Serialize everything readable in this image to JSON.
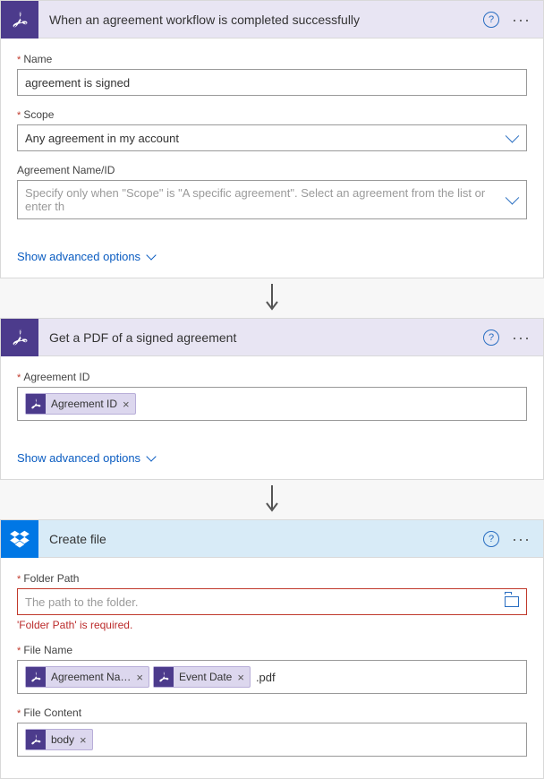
{
  "step1": {
    "title": "When an agreement workflow is completed successfully",
    "name_label": "Name",
    "name_value": "agreement is signed",
    "scope_label": "Scope",
    "scope_value": "Any agreement in my account",
    "agreement_label": "Agreement Name/ID",
    "agreement_placeholder": "Specify only when \"Scope\" is \"A specific agreement\". Select an agreement from the list or enter th"
  },
  "show_advanced": "Show advanced options",
  "step2": {
    "title": "Get a PDF of a signed agreement",
    "agreement_id_label": "Agreement ID",
    "token_agreement_id": "Agreement ID"
  },
  "step3": {
    "title": "Create file",
    "folder_label": "Folder Path",
    "folder_placeholder": "The path to the folder.",
    "folder_error": "'Folder Path' is required.",
    "file_name_label": "File Name",
    "token_agreement_name": "Agreement Na…",
    "token_event_date": "Event Date",
    "file_name_suffix": ".pdf",
    "file_content_label": "File Content",
    "token_body": "body"
  }
}
